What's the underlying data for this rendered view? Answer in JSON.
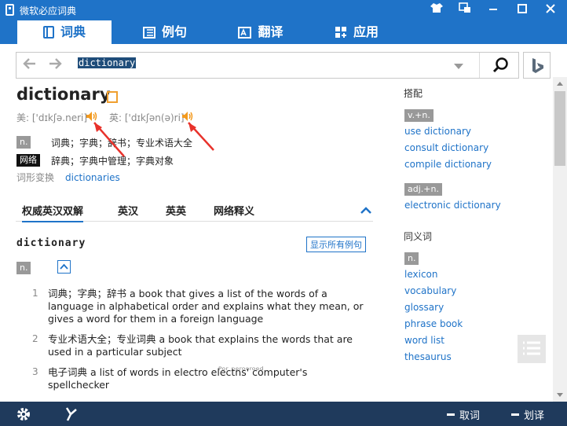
{
  "app": {
    "title": "微软必应词典"
  },
  "tabs": [
    {
      "label": "词典",
      "icon": "book-icon"
    },
    {
      "label": "例句",
      "icon": "sentence-icon"
    },
    {
      "label": "翻译",
      "icon": "translate-icon"
    },
    {
      "label": "应用",
      "icon": "apps-icon"
    }
  ],
  "search": {
    "value": "dictionary"
  },
  "entry": {
    "headword": "dictionary",
    "us_label": "美:",
    "us_phonetic": "['dɪkʃə.neri]",
    "uk_label": "英:",
    "uk_phonetic": "['dɪkʃən(ə)ri]",
    "pos_n": "n.",
    "def_n": "词典；字典；辞书；专业术语大全",
    "web_label": "网络",
    "def_web": "辞典；字典中管理；字典对象",
    "inflection_label": "词形变换",
    "inflection_value": "dictionaries"
  },
  "subtabs": [
    "权威英汉双解",
    "英汉",
    "英英",
    "网络释义"
  ],
  "definition": {
    "word": "dictionary",
    "show_examples": "显示所有例句",
    "pos": "n.",
    "senses": [
      {
        "num": "1",
        "text": "词典；字典；辞书 a book that gives a list of the words of a language in alphabetical order and explains what they mean, or gives a word for them in a foreign language"
      },
      {
        "num": "2",
        "text": "专业术语大全；专业词典 a book that explains the words that are used in a particular subject"
      },
      {
        "num": "3",
        "text": "电子词典 a list of words in electro electns' computer's spellchecker"
      }
    ],
    "sense3_ghost": "ᴾᵒʳ ᵖᵉʳᵒᵒʳᵒᵉᵈ"
  },
  "sidebar": {
    "collocation_title": "搭配",
    "vn_tag": "v.+n.",
    "vn_items": [
      "use dictionary",
      "consult dictionary",
      "compile dictionary"
    ],
    "adjn_tag": "adj.+n.",
    "adjn_items": [
      "electronic dictionary"
    ],
    "synonym_title": "同义词",
    "syn_tag": "n.",
    "syn_items": [
      "lexicon",
      "vocabulary",
      "glossary",
      "phrase book",
      "word list",
      "thesaurus"
    ]
  },
  "bottom": {
    "pick_word": "取词",
    "select_translate": "划译"
  },
  "colors": {
    "accent": "#1f73c8",
    "bottom": "#1f3a5c",
    "speaker": "#f39a1e",
    "annotation": "#e8322b"
  }
}
